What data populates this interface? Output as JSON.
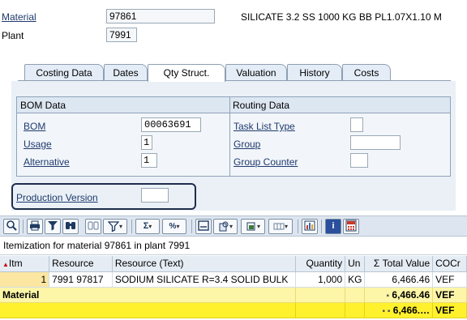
{
  "header": {
    "material_label": "Material",
    "material_value": "97861",
    "material_description": "SILICATE 3.2 SS 1000 KG BB PL1.07X1.10 M",
    "plant_label": "Plant",
    "plant_value": "7991"
  },
  "tabs": [
    {
      "label": "Costing Data",
      "active": false
    },
    {
      "label": "Dates",
      "active": false
    },
    {
      "label": "Qty Struct.",
      "active": true
    },
    {
      "label": "Valuation",
      "active": false
    },
    {
      "label": "History",
      "active": false
    },
    {
      "label": "Costs",
      "active": false
    }
  ],
  "bom": {
    "title": "BOM Data",
    "bom_label": "BOM",
    "bom_value": "00063691",
    "usage_label": "Usage",
    "usage_value": "1",
    "alternative_label": "Alternative",
    "alternative_value": "1"
  },
  "routing": {
    "title": "Routing Data",
    "task_list_type_label": "Task List Type",
    "task_list_type_value": "",
    "group_label": "Group",
    "group_value": "",
    "group_counter_label": "Group Counter",
    "group_counter_value": ""
  },
  "production_version": {
    "label": "Production Version",
    "value": ""
  },
  "toolbar": {
    "icons": [
      "details-icon",
      "print-icon",
      "filter-icon",
      "find-icon",
      "find-next-icon",
      "set-filter-icon",
      "sum-icon",
      "subtotal-icon",
      "print-preview-icon",
      "export-icon",
      "layout-icon",
      "select-layout-icon",
      "graphic-icon",
      "info-icon",
      "calculator-icon"
    ]
  },
  "itemization": {
    "title": "Itemization for material 97861 in plant 7991",
    "columns": [
      "Itm",
      "Resource",
      "Resource (Text)",
      "Quantity",
      "Un",
      "Σ Total Value",
      "COCr"
    ],
    "rows": [
      {
        "item": "1",
        "resource": "7991 97817",
        "resource_text": "SODIUM SILICATE R=3.4 SOLID BULK",
        "quantity": "1,000",
        "unit": "KG",
        "total_value": "6,466.46",
        "currency": "VEF"
      }
    ],
    "subtotal": {
      "label": "Material",
      "marker": "▪",
      "total_value": "6,466.46",
      "currency": "VEF"
    },
    "grand_total": {
      "marker": "▪ ▪",
      "total_value": "6,466.…",
      "currency": "VEF"
    }
  }
}
